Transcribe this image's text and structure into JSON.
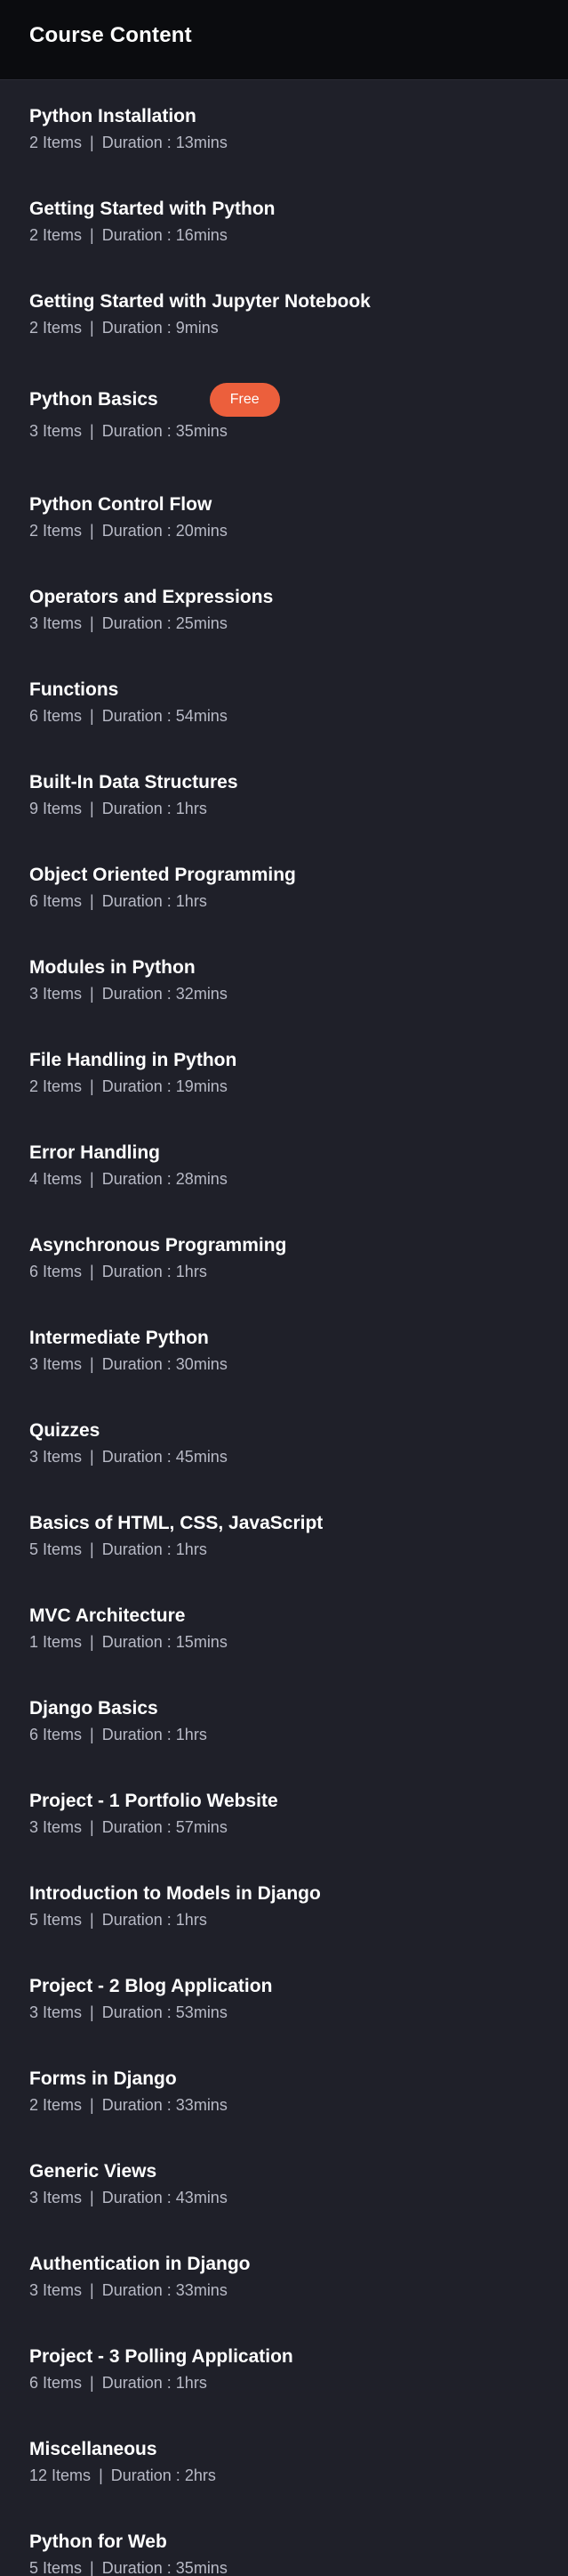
{
  "header": {
    "title": "Course Content"
  },
  "labels": {
    "items_word": "Items",
    "separator": "|",
    "duration_word": "Duration :"
  },
  "accent": "#ec5f3c",
  "sections": [
    {
      "title": "Python Installation",
      "items": "2",
      "duration": "13mins"
    },
    {
      "title": "Getting Started with Python",
      "items": "2",
      "duration": "16mins"
    },
    {
      "title": "Getting Started with Jupyter Notebook",
      "items": "2",
      "duration": "9mins"
    },
    {
      "title": "Python Basics",
      "items": "3",
      "duration": "35mins",
      "badge": "Free"
    },
    {
      "title": "Python Control Flow",
      "items": "2",
      "duration": "20mins"
    },
    {
      "title": "Operators and Expressions",
      "items": "3",
      "duration": "25mins"
    },
    {
      "title": "Functions",
      "items": "6",
      "duration": "54mins"
    },
    {
      "title": "Built-In Data Structures",
      "items": "9",
      "duration": "1hrs"
    },
    {
      "title": "Object Oriented Programming",
      "items": "6",
      "duration": "1hrs"
    },
    {
      "title": "Modules in Python",
      "items": "3",
      "duration": "32mins"
    },
    {
      "title": "File Handling in Python",
      "items": "2",
      "duration": "19mins"
    },
    {
      "title": "Error Handling",
      "items": "4",
      "duration": "28mins"
    },
    {
      "title": "Asynchronous Programming",
      "items": "6",
      "duration": "1hrs"
    },
    {
      "title": "Intermediate Python",
      "items": "3",
      "duration": "30mins"
    },
    {
      "title": "Quizzes",
      "items": "3",
      "duration": "45mins"
    },
    {
      "title": "Basics of HTML, CSS, JavaScript",
      "items": "5",
      "duration": "1hrs"
    },
    {
      "title": "MVC Architecture",
      "items": "1",
      "duration": "15mins"
    },
    {
      "title": "Django Basics",
      "items": "6",
      "duration": "1hrs"
    },
    {
      "title": "Project - 1 Portfolio Website",
      "items": "3",
      "duration": "57mins"
    },
    {
      "title": "Introduction to Models in Django",
      "items": "5",
      "duration": "1hrs"
    },
    {
      "title": "Project - 2 Blog Application",
      "items": "3",
      "duration": "53mins"
    },
    {
      "title": "Forms in Django",
      "items": "2",
      "duration": "33mins"
    },
    {
      "title": "Generic Views",
      "items": "3",
      "duration": "43mins"
    },
    {
      "title": "Authentication in Django",
      "items": "3",
      "duration": "33mins"
    },
    {
      "title": "Project - 3 Polling Application",
      "items": "6",
      "duration": "1hrs"
    },
    {
      "title": "Miscellaneous",
      "items": "12",
      "duration": "2hrs"
    },
    {
      "title": "Python for Web",
      "items": "5",
      "duration": "35mins"
    }
  ]
}
